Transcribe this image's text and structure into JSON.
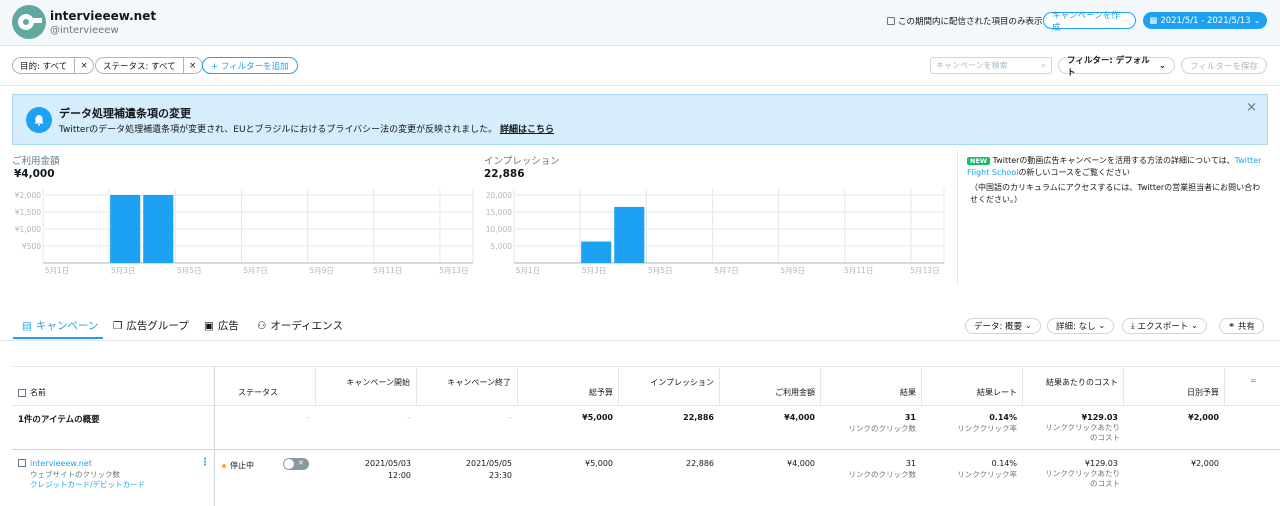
{
  "account": {
    "name": "intervieeew.net",
    "handle": "@intervieeew"
  },
  "header": {
    "checkbox_label": "この期間内に配信された項目のみ表示",
    "create_campaign": "キャンペーンを作成",
    "date_range": "2021/5/1 - 2021/5/13"
  },
  "filters": {
    "objective": "目的: すべて",
    "status": "ステータス: すべて",
    "add_filter": "+ フィルターを追加",
    "search_placeholder": "キャンペーンを検索",
    "filter_default": "フィルター: デフォルト",
    "save_filter": "フィルターを保存"
  },
  "banner": {
    "title": "データ処理補遺条項の変更",
    "body": "Twitterのデータ処理補遺条項が変更され、EUとブラジルにおけるプライバシー法の変更が反映されました。",
    "link": "詳細はこちら",
    "close": "×"
  },
  "spend": {
    "label": "ご利用金額",
    "value": "¥4,000"
  },
  "impressions": {
    "label": "インプレッション",
    "value": "22,886"
  },
  "chart_data": [
    {
      "type": "bar",
      "title": "ご利用金額",
      "categories": [
        "5月1日",
        "5月2日",
        "5月3日",
        "5月4日",
        "5月5日",
        "5月6日",
        "5月7日",
        "5月8日",
        "5月9日",
        "5月10日",
        "5月11日",
        "5月12日",
        "5月13日"
      ],
      "tick_labels": [
        "5月1日",
        "5月3日",
        "5月5日",
        "5月7日",
        "5月9日",
        "5月11日",
        "5月13日"
      ],
      "y_ticks": [
        "¥2,000",
        "¥1,500",
        "¥1,000",
        "¥500"
      ],
      "values": [
        0,
        0,
        2000,
        2000,
        0,
        0,
        0,
        0,
        0,
        0,
        0,
        0,
        0
      ],
      "ylim": [
        0,
        2000
      ],
      "color": "#1da1f2"
    },
    {
      "type": "bar",
      "title": "インプレッション",
      "categories": [
        "5月1日",
        "5月2日",
        "5月3日",
        "5月4日",
        "5月5日",
        "5月6日",
        "5月7日",
        "5月8日",
        "5月9日",
        "5月10日",
        "5月11日",
        "5月12日",
        "5月13日"
      ],
      "tick_labels": [
        "5月1日",
        "5月3日",
        "5月5日",
        "5月7日",
        "5月9日",
        "5月11日",
        "5月13日"
      ],
      "y_ticks": [
        "20,000",
        "15,000",
        "10,000",
        "5,000"
      ],
      "values": [
        0,
        0,
        6300,
        16500,
        0,
        0,
        0,
        0,
        0,
        0,
        0,
        0,
        0
      ],
      "ylim": [
        0,
        20000
      ],
      "color": "#1da1f2"
    }
  ],
  "promo": {
    "badge": "NEW",
    "text1": "Twitterの動画広告キャンペーンを活用する方法の詳細については、",
    "link": "Twitter Flight School",
    "text2": "の新しいコースをご覧ください",
    "note": "（中国語のカリキュラムにアクセスするには、Twitterの営業担当者にお問い合わせください。）"
  },
  "tabs": [
    "キャンペーン",
    "広告グループ",
    "広告",
    "オーディエンス"
  ],
  "table_tools": {
    "data": "データ: 概要",
    "detail": "詳細: なし",
    "export": "エクスポート",
    "share": "共有"
  },
  "table": {
    "headers": {
      "name": "名前",
      "status": "ステータス",
      "start": "キャンペーン開始",
      "end": "キャンペーン終了",
      "budget": "総予算",
      "impressions": "インプレッション",
      "spend": "ご利用金額",
      "results": "結果",
      "result_rate": "結果レート",
      "cost_per": "結果あたりのコスト",
      "daily": "日別予算"
    },
    "summary": {
      "label": "1件のアイテムの概要",
      "status": "–",
      "start": "–",
      "end": "–",
      "budget": "¥5,000",
      "impressions": "22,886",
      "spend": "¥4,000",
      "results": "31",
      "results_sub": "リンクのクリック数",
      "rate": "0.14%",
      "rate_sub": "リンククリック率",
      "cost": "¥129.03",
      "cost_sub": "リンククリックあたりのコスト",
      "daily": "¥2,000"
    },
    "row": {
      "name": "intervieeew.net",
      "line2": "ウェブサイトのクリック数",
      "line3": "クレジットカード/デビットカード",
      "status": "停止中",
      "start_date": "2021/05/03",
      "start_time": "12:00",
      "end_date": "2021/05/05",
      "end_time": "23:30",
      "budget": "¥5,000",
      "impressions": "22,886",
      "spend": "¥4,000",
      "results": "31",
      "results_sub": "リンクのクリック数",
      "rate": "0.14%",
      "rate_sub": "リンククリック率",
      "cost": "¥129.03",
      "cost_sub": "リンククリックあたりのコスト",
      "daily": "¥2,000"
    }
  }
}
